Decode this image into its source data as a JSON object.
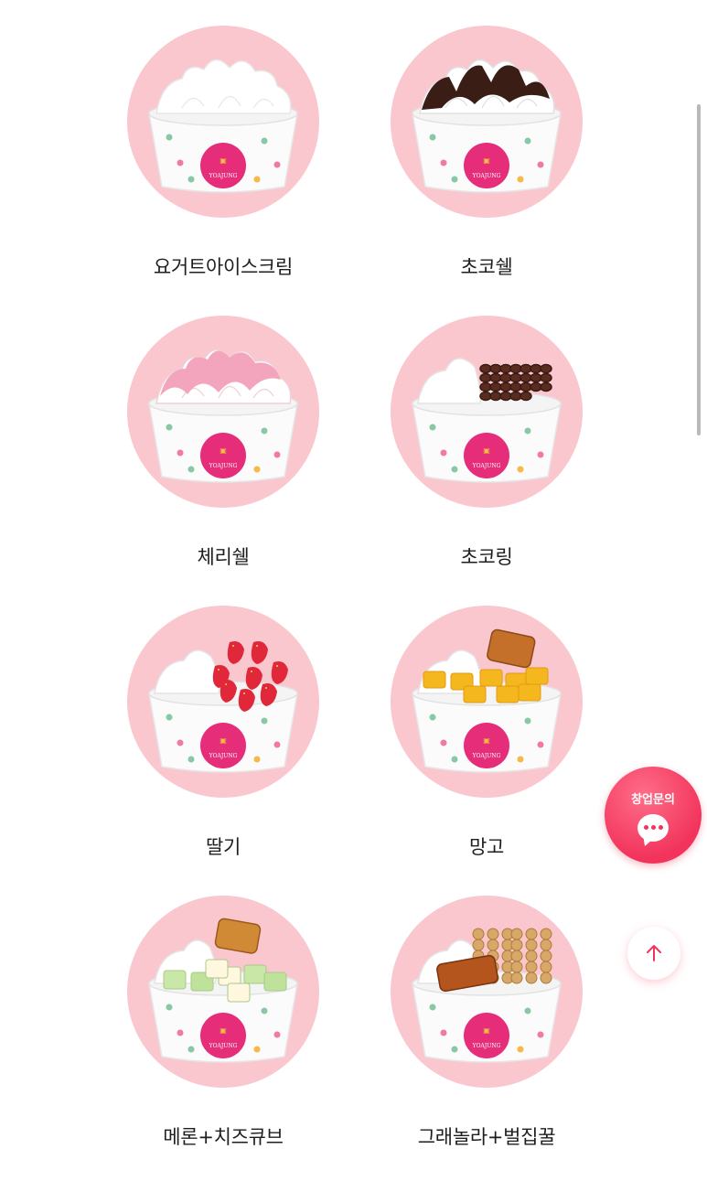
{
  "menu": {
    "items": [
      {
        "name": "요거트아이스크림",
        "topping": "plain"
      },
      {
        "name": "초코쉘",
        "topping": "choco-shell"
      },
      {
        "name": "체리쉘",
        "topping": "cherry-shell"
      },
      {
        "name": "초코링",
        "topping": "choco-ring"
      },
      {
        "name": "딸기",
        "topping": "strawberry"
      },
      {
        "name": "망고",
        "topping": "mango"
      },
      {
        "name": "메론+치즈큐브",
        "topping": "melon-cheese"
      },
      {
        "name": "그래놀라+벌집꿀",
        "topping": "granola-honeycomb"
      }
    ],
    "cup_logo_text": "YOAJUNG"
  },
  "floating": {
    "inquiry_label": "창업문의",
    "inquiry_icon": "chat-bubble-icon",
    "top_icon": "arrow-up-icon"
  },
  "colors": {
    "circle_bg": "#fbc7cf",
    "accent": "#f2345c"
  }
}
